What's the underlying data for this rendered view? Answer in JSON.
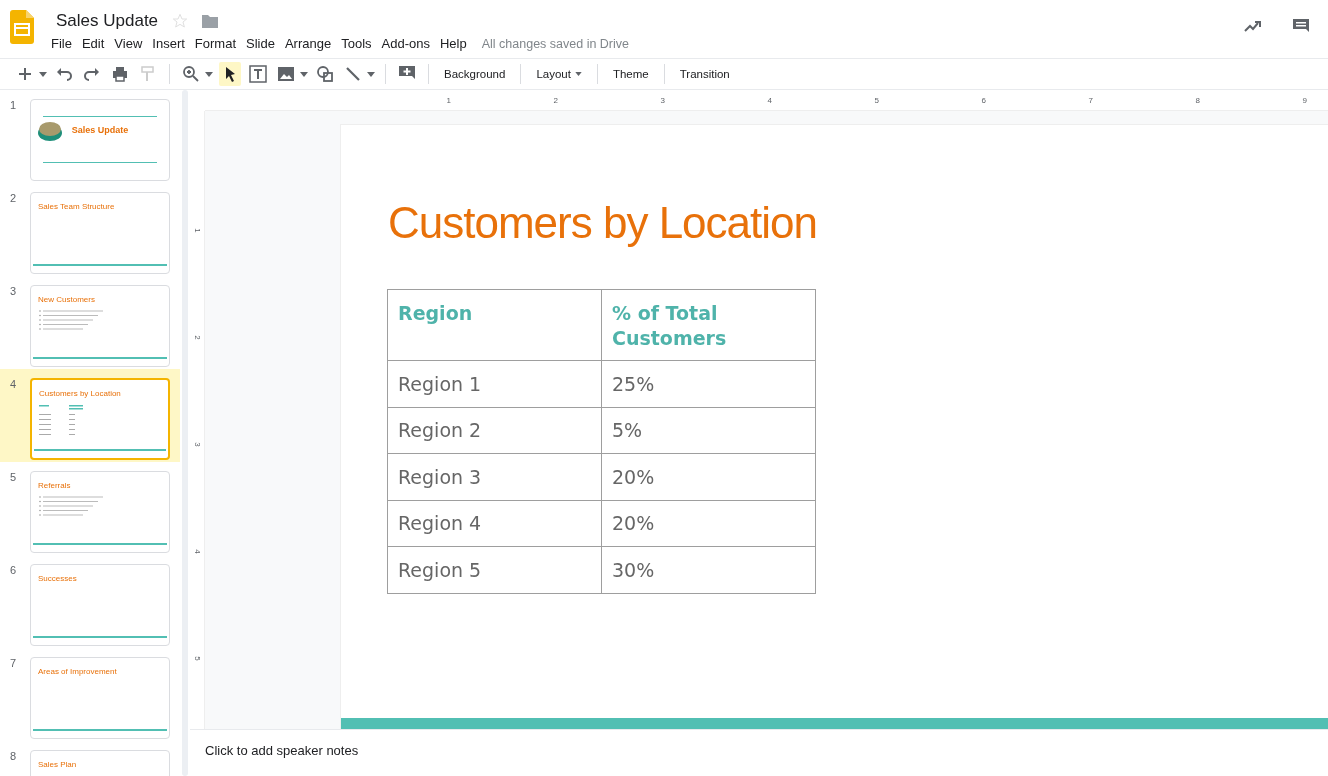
{
  "document": {
    "title": "Sales Update",
    "save_status": "All changes saved in Drive"
  },
  "menu": [
    "File",
    "Edit",
    "View",
    "Insert",
    "Format",
    "Slide",
    "Arrange",
    "Tools",
    "Add-ons",
    "Help"
  ],
  "toolbar": {
    "pointer_tool": {
      "selected": true
    },
    "text_buttons": [
      {
        "label": "Background",
        "dropdown": false
      },
      {
        "label": "Layout",
        "dropdown": true
      },
      {
        "label": "Theme",
        "dropdown": false
      },
      {
        "label": "Transition",
        "dropdown": false
      }
    ]
  },
  "horizontal_ruler": [
    "1",
    "2",
    "3",
    "4",
    "5",
    "6",
    "7",
    "8",
    "9"
  ],
  "vertical_ruler": [
    "1",
    "2",
    "3",
    "4",
    "5"
  ],
  "slides": [
    {
      "number": "1",
      "title": "Sales Update",
      "kind": "title",
      "selected": false
    },
    {
      "number": "2",
      "title": "Sales Team Structure",
      "kind": "blank",
      "selected": false
    },
    {
      "number": "3",
      "title": "New Customers",
      "kind": "bullets",
      "selected": false
    },
    {
      "number": "4",
      "title": "Customers by Location",
      "kind": "table",
      "selected": true
    },
    {
      "number": "5",
      "title": "Referrals",
      "kind": "bullets",
      "selected": false
    },
    {
      "number": "6",
      "title": "Successes",
      "kind": "blank",
      "selected": false
    },
    {
      "number": "7",
      "title": "Areas of Improvement",
      "kind": "blank",
      "selected": false
    },
    {
      "number": "8",
      "title": "Sales Plan",
      "kind": "blank",
      "selected": false
    }
  ],
  "current_slide": {
    "title": "Customers by Location",
    "table": {
      "columns": [
        "Region",
        "% of Total Customers"
      ],
      "rows": [
        [
          "Region 1",
          "25%"
        ],
        [
          "Region 2",
          "5%"
        ],
        [
          "Region 3",
          "20%"
        ],
        [
          "Region 4",
          "20%"
        ],
        [
          "Region 5",
          "30%"
        ]
      ]
    }
  },
  "speaker_notes": {
    "placeholder": "Click to add speaker notes"
  }
}
